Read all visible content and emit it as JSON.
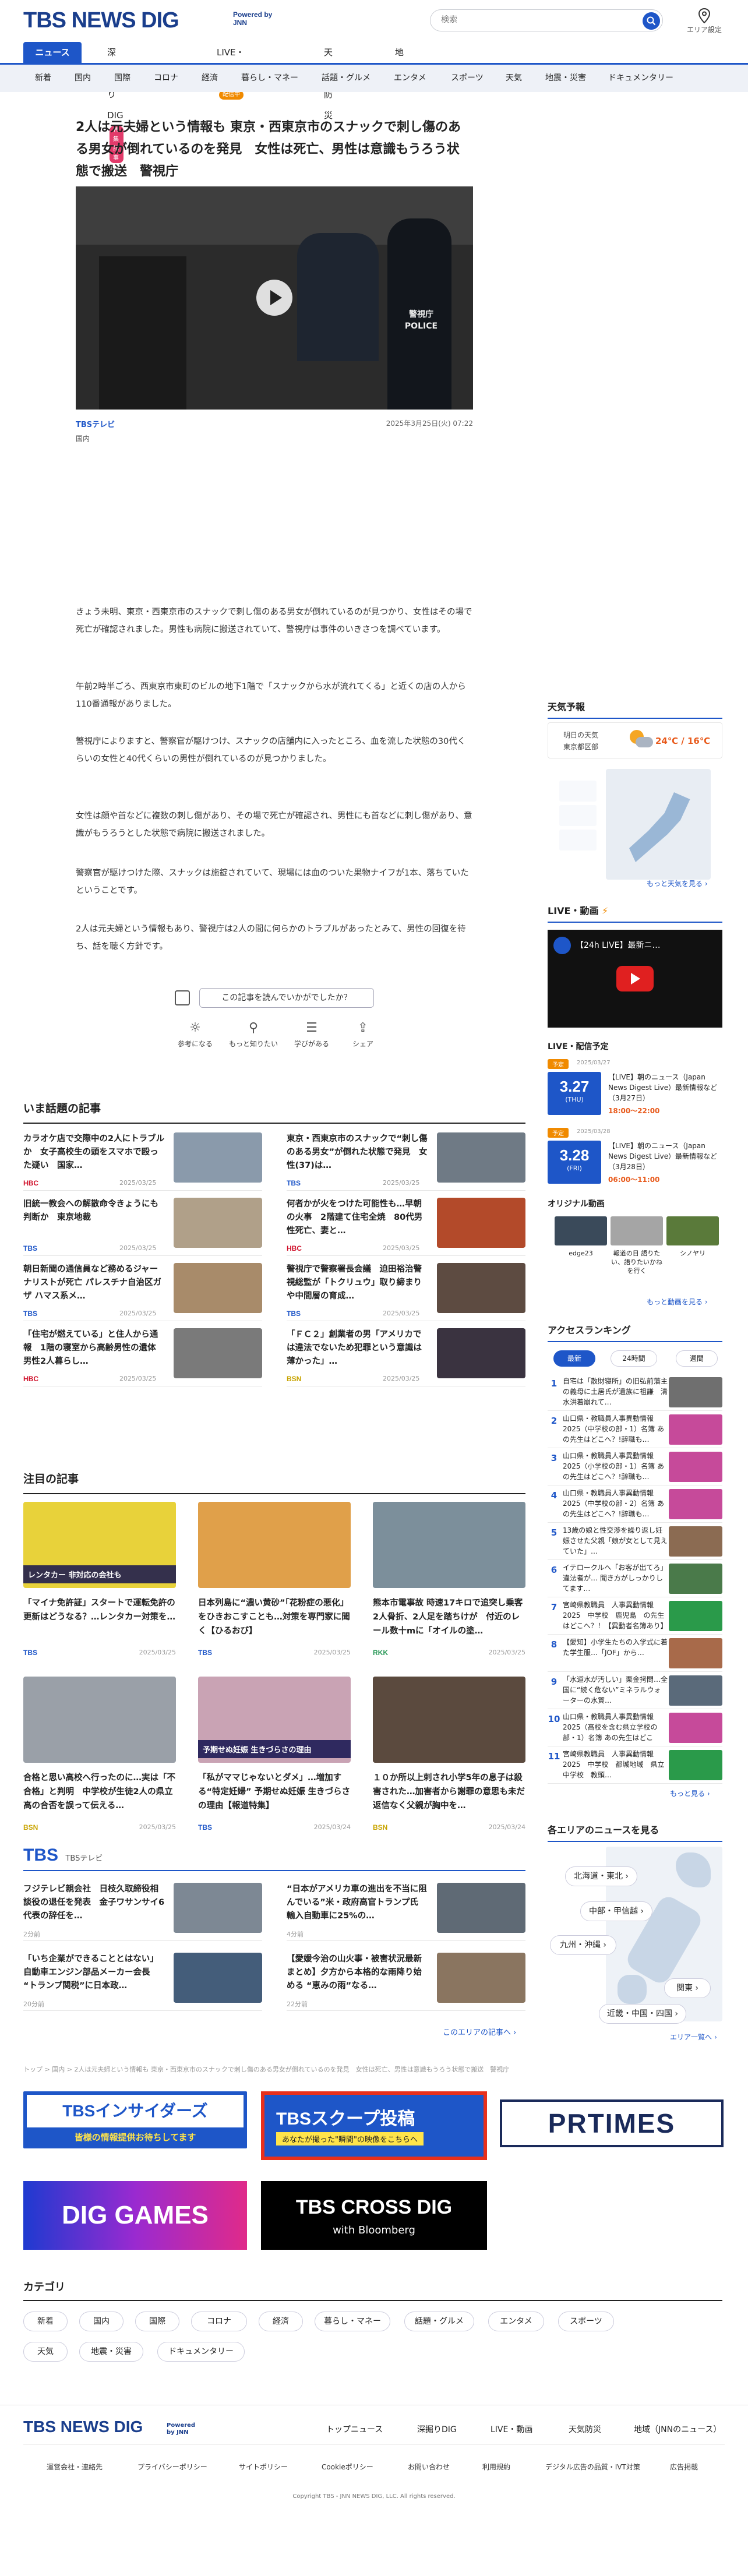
{
  "header": {
    "logo_tbs": "TBS",
    "logo_newsdig": "NEWS DIG",
    "powered_by": "Powered by",
    "powered_jnn": "JNN",
    "search_placeholder": "検索",
    "area_select": "エリア設定"
  },
  "main_nav": [
    {
      "label": "ニュース"
    },
    {
      "label": "深掘りDIG",
      "badge": "特集記事"
    },
    {
      "label": "LIVE・動画",
      "badge": "配信中"
    },
    {
      "label": "天気防災"
    },
    {
      "label": "地域"
    }
  ],
  "sub_nav": [
    "新着",
    "国内",
    "国際",
    "コロナ",
    "経済",
    "暮らし・マネー",
    "話題・グルメ",
    "エンタメ",
    "スポーツ",
    "天気",
    "地震・災害",
    "ドキュメンタリー"
  ],
  "article": {
    "title": "2人は元夫婦という情報も 東京・西東京市のスナックで刺し傷のある男女が倒れているのを発見　女性は死亡、男性は意識もうろう状態で搬送　警視庁",
    "source": "TBSテレビ",
    "date": "2025年3月25日(火) 07:22",
    "category": "国内",
    "hero_sign_1": "警視庁",
    "hero_sign_2": "POLICE",
    "paragraphs": [
      "きょう未明、東京・西東京市のスナックで刺し傷のある男女が倒れているのが見つかり、女性はその場で死亡が確認されました。男性も病院に搬送されていて、警視庁は事件のいきさつを調べています。",
      "午前2時半ごろ、西東京市東町のビルの地下1階で「スナックから水が流れてくる」と近くの店の人から110番通報がありました。",
      "警視庁によりますと、警察官が駆けつけ、スナックの店舗内に入ったところ、血を流した状態の30代くらいの女性と40代くらいの男性が倒れているのが見つかりました。",
      "女性は顔や首などに複数の刺し傷があり、その場で死亡が確認され、男性にも首などに刺し傷があり、意識がもうろうとした状態で病院に搬送されました。",
      "警察官が駆けつけた際、スナックは施錠されていて、現場には血のついた果物ナイフが1本、落ちていたということです。",
      "2人は元夫婦という情報もあり、警視庁は2人の間に何らかのトラブルがあったとみて、男性の回復を待ち、話を聴く方針です。"
    ],
    "survey_question": "この記事を読んでいかがでしたか？",
    "reactions": [
      "参考になる",
      "もっと知りたい",
      "学びがある",
      "シェア"
    ]
  },
  "trending": {
    "heading": "いま話題の記事",
    "items": [
      {
        "title": "カラオケ店で交際中の2人にトラブルか　女子高校生の頭をスマホで殴った疑い　国家…",
        "source": "HBC",
        "source_color": "#d0102a",
        "date": "2025/03/25",
        "thumb": "#8a9aab"
      },
      {
        "title": "東京・西東京市のスナックで“刺し傷のある男女”が倒れた状態で発見　女性(37)は…",
        "source": "TBS",
        "source_color": "#1e56c8",
        "date": "2025/03/25",
        "thumb": "#6f7a85"
      },
      {
        "title": "旧統一教会への解散命令きょうにも判断か　東京地裁",
        "source": "TBS",
        "source_color": "#1e56c8",
        "date": "2025/03/25",
        "thumb": "#b0a089"
      },
      {
        "title": "何者かが火をつけた可能性も…早朝の火事　2階建て住宅全焼　80代男性死亡、妻と…",
        "source": "HBC",
        "source_color": "#d0102a",
        "date": "2025/03/25",
        "thumb": "#b34a2a"
      },
      {
        "title": "朝日新聞の通信員など務めるジャーナリストが死亡 パレスチナ自治区ガザ ハマス系メ…",
        "source": "TBS",
        "source_color": "#1e56c8",
        "date": "2025/03/25",
        "thumb": "#a88b6a"
      },
      {
        "title": "警視庁で警察署長会議　迫田裕治警視総監が「トクリュウ」取り締まりや中間層の育成…",
        "source": "TBS",
        "source_color": "#1e56c8",
        "date": "2025/03/25",
        "thumb": "#5d4b41"
      },
      {
        "title": "「住宅が燃えている」と住人から通報　1階の寝室から高齢男性の遺体　男性2人暮らし…",
        "source": "HBC",
        "source_color": "#d0102a",
        "date": "2025/03/25",
        "thumb": "#7a7a7a"
      },
      {
        "title": "「ＦＣ２」創業者の男「アメリカでは違法でないため犯罪という意識は薄かった」…",
        "source": "BSN",
        "source_color": "#c8a400",
        "date": "2025/03/25",
        "thumb": "#3a3340"
      }
    ]
  },
  "featured": {
    "heading": "注目の記事",
    "items": [
      {
        "title": "「マイナ免許証」スタートで運転免許の更新はどうなる？…レンタカー対策を…",
        "source": "TBS",
        "source_color": "#1e56c8",
        "date": "2025/03/25",
        "thumb": "#e8d23a",
        "overlay": "レンタカー 非対応の会社も"
      },
      {
        "title": "日本列島に“濃い黄砂”「花粉症の悪化」をひきおこすことも…対策を専門家に聞く【ひるおび】",
        "source": "TBS",
        "source_color": "#1e56c8",
        "date": "2025/03/25",
        "thumb": "#e0a04a",
        "overlay": ""
      },
      {
        "title": "熊本市電事故 時速17キロで追突し乗客2人骨折、2人足を踏ちけが　付近のレール数十mに「オイルの塗…",
        "source": "RKK",
        "source_color": "#2c9a5a",
        "date": "2025/03/25",
        "thumb": "#7c8f9b",
        "overlay": ""
      },
      {
        "title": "合格と思い高校へ行ったのに…実は「不合格」と判明　中学校が生徒2人の県立高の合否を誤って伝える…",
        "source": "BSN",
        "source_color": "#c8a400",
        "date": "2025/03/25",
        "thumb": "#9aa0a8",
        "overlay": ""
      },
      {
        "title": "「私がママじゃないとダメ」…増加する“特定妊婦” 予期せぬ妊娠 生きづらさの理由【報道特集】",
        "source": "TBS",
        "source_color": "#1e56c8",
        "date": "2025/03/24",
        "thumb": "#c9a3b4",
        "overlay": "予期せぬ妊娠 生きづらさの理由"
      },
      {
        "title": "１０か所以上刺され小学5年の息子は殺害された…加害者から謝罪の意思も未だ返信なく父親が胸中を…",
        "source": "BSN",
        "source_color": "#c8a400",
        "date": "2025/03/24",
        "thumb": "#5b4a3e",
        "overlay": ""
      }
    ]
  },
  "tbs_section": {
    "logo": "TBS",
    "channel": "TBSテレビ",
    "items": [
      {
        "title": "フジテレビ親会社　日枝久取締役相談役の退任を発表　金子ワサンサイ6代表の辞任を…",
        "date": "2分前",
        "thumb": "#7d8894"
      },
      {
        "title": "“日本がアメリカ車の進出を不当に阻んでいる”米・政府高官トランプ氏 輸入自動車に25%の…",
        "date": "4分前",
        "thumb": "#5f6a75"
      },
      {
        "title": "「いち企業ができることとはない」自動車エンジン部品メーカー会長 “トランプ関税”に日本政…",
        "date": "20分前",
        "thumb": "#445d7a"
      },
      {
        "title": "【愛媛今治の山火事・被害状況最新まとめ】夕方から本格的な雨降り始める “恵みの雨”なる…",
        "date": "22分前",
        "thumb": "#8a7560"
      }
    ],
    "more": "このエリアの記事へ"
  },
  "breadcrumb": "トップ > 国内 > 2人は元夫婦という情報も 東京・西東京市のスナックで刺し傷のある男女が倒れているのを発見　女性は死亡、男性は意識もうろう状態で搬送　警視庁",
  "banners": [
    {
      "label": "TBSインサイダーズ",
      "sub": "皆様の情報提供お待ちしてます"
    },
    {
      "label": "TBSスクープ投稿",
      "sub": "あなたが撮った\"瞬間\"の映像をこちらへ"
    },
    {
      "label": "PRTIMES",
      "sub": ""
    },
    {
      "label": "DIG GAMES",
      "sub": ""
    },
    {
      "label": "TBS CROSS DIG",
      "sub": "with Bloomberg"
    }
  ],
  "categories": {
    "heading": "カテゴリ",
    "items": [
      "新着",
      "国内",
      "国際",
      "コロナ",
      "経済",
      "暮らし・マネー",
      "話題・グルメ",
      "エンタメ",
      "スポーツ",
      "天気",
      "地震・災害",
      "ドキュメンタリー"
    ]
  },
  "footer": {
    "logo": "TBS NEWS DIG",
    "powered": "Powered by JNN",
    "nav": [
      "トップニュース",
      "深掘りDIG",
      "LIVE・動画",
      "天気防災",
      "地域（JNNのニュース）"
    ],
    "links": [
      "運営会社・連絡先",
      "プライバシーポリシー",
      "サイトポリシー",
      "Cookieポリシー",
      "お問い合わせ",
      "利用規約",
      "デジタル広告の品質・IVT対策",
      "広告掲載"
    ],
    "copyright": "Copyright TBS - JNN NEWS DIG, LLC. All rights reserved."
  },
  "sidebar": {
    "weather": {
      "heading": "天気予報",
      "forecast_label": "明日の天気",
      "area": "東京都区部",
      "temp": "24℃ / 16℃",
      "more": "もっと天気を見る"
    },
    "live": {
      "heading": "LIVE・動画",
      "player_title": "【24h LIVE】最新ニ…",
      "schedule_heading": "LIVE・配信予定",
      "schedule": [
        {
          "tag": "予定",
          "date_big": "3.27",
          "weekday": "(THU)",
          "date": "2025/03/27",
          "title": "【LIVE】朝のニュース（Japan News Digest Live）最新情報など（3月27日）",
          "time": "18:00〜22:00"
        },
        {
          "tag": "予定",
          "date_big": "3.28",
          "weekday": "(FRI)",
          "date": "2025/03/28",
          "title": "【LIVE】朝のニュース（Japan News Digest Live）最新情報など（3月28日）",
          "time": "06:00〜11:00"
        }
      ],
      "original_heading": "オリジナル動画",
      "originals": [
        {
          "label": "edge23",
          "color": "#3a4a5a"
        },
        {
          "label": "報道の日 語りたい、語りたいかねを行く",
          "color": "#a5a5a5"
        },
        {
          "label": "シノヤリ",
          "color": "#5a7a3a"
        }
      ],
      "more": "もっと動画を見る"
    },
    "ranking": {
      "heading": "アクセスランキング",
      "tabs": [
        "最新",
        "24時間",
        "週間"
      ],
      "items": [
        {
          "title": "自宅は「散財寝所」の旧弘前藩主の義母に土居氏が遺族に祖謙　清水洪着崩れて…",
          "thumb": "#6f6f6f"
        },
        {
          "title": "山口県・教職員人事異動情報 2025（中学校の部・1）名簿 あの先生はどこへ？!辞職も…",
          "thumb": "#c64a9a"
        },
        {
          "title": "山口県・教職員人事異動情報 2025（小学校の部・1）名簿 あの先生はどこへ？!辞職も…",
          "thumb": "#c64a9a"
        },
        {
          "title": "山口県・教職員人事異動情報 2025（中学校の部・2）名簿 あの先生はどこへ？!辞職も…",
          "thumb": "#c64a9a"
        },
        {
          "title": "13歳の娘と性交渉を繰り返し妊娠させた父親「娘が女として見えていた」…",
          "thumb": "#8b6b52"
        },
        {
          "title": "イテロークルへ「お客が出てろ」違法者が… 聞き方がしっかりしてます…",
          "thumb": "#4a7a4a"
        },
        {
          "title": "宮崎県教職員　人事異動情報 2025　中学校　鹿児島　の先生はどこへ？！【異動者名簿あり】",
          "thumb": "#2a9a4a"
        },
        {
          "title": "【愛知】小学生たちの入学式に着た学生服…「JOF」から…",
          "thumb": "#a86a4a"
        },
        {
          "title": "「水道水が汚しい」栗金拷問…全国に“続く危ない”ミネラルウォーターの水質…",
          "thumb": "#5a6a7a"
        },
        {
          "title": "山口県・教職員人事異動情報 2025（高校を含む県立学校の部・1）名簿 あの先生はどこへ？…",
          "thumb": "#c64a9a"
        },
        {
          "title": "宮崎県教職員　人事異動情報 2025　中学校　都城地域　県立中学校　教頭…",
          "thumb": "#2a9a4a"
        }
      ],
      "more": "もっと見る"
    },
    "areas": {
      "heading": "各エリアのニュースを見る",
      "buttons": [
        "北海道・東北",
        "中部・甲信越",
        "九州・沖縄",
        "関東",
        "近畿・中国・四国"
      ],
      "more": "エリア一覧へ"
    }
  }
}
